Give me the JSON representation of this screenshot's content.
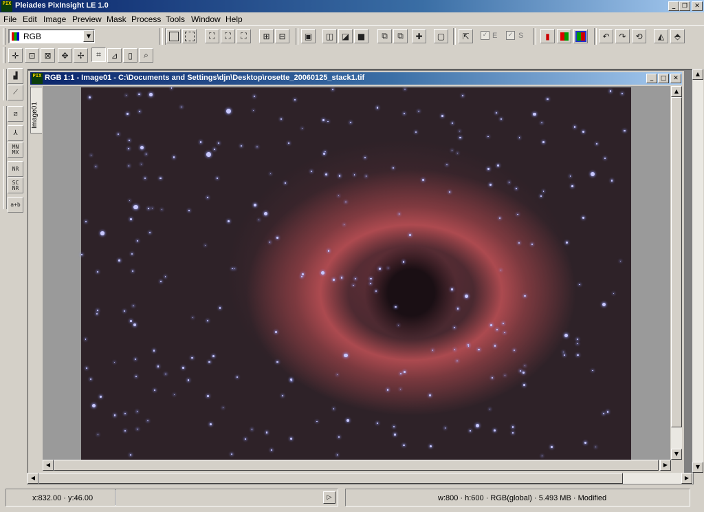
{
  "app": {
    "title": "Pleiades PixInsight LE 1.0",
    "logo_text": "PIX"
  },
  "menu": [
    "File",
    "Edit",
    "Image",
    "Preview",
    "Mask",
    "Process",
    "Tools",
    "Window",
    "Help"
  ],
  "toolbar": {
    "color_space_value": "RGB",
    "check_e_label": "E",
    "check_s_label": "S"
  },
  "image_window": {
    "title": "RGB 1:1 - Image01 - C:\\Documents and Settings\\djn\\Desktop\\rosette_20060125_stack1.tif",
    "tab_label": "Image01"
  },
  "status": {
    "coordinates": "x:832.00 · y:46.00",
    "image_info": "w:800 · h:600 · RGB(global) · 5.493 MB · Modified"
  },
  "colors": {
    "title_bar_start": "#0a246a",
    "title_bar_end": "#a6caf0",
    "window_face": "#d4d0c8",
    "workspace": "#808080",
    "nebula": "#be5055"
  }
}
